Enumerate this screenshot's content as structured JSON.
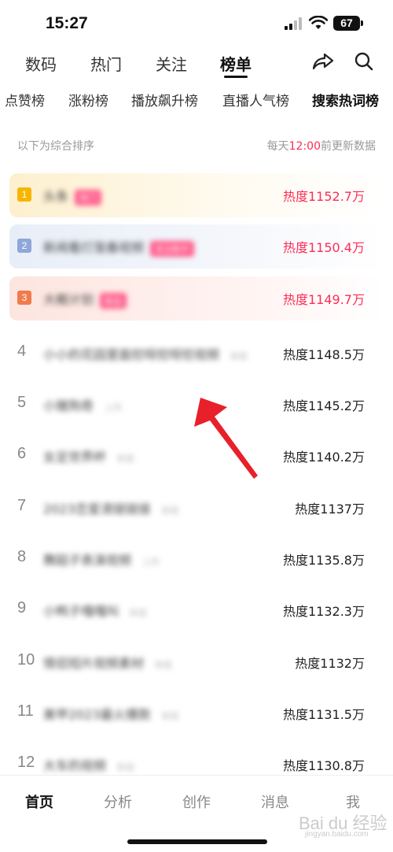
{
  "status": {
    "time": "15:27",
    "battery": "67"
  },
  "topnav": {
    "tabs": [
      "数码",
      "热门",
      "关注",
      "榜单"
    ],
    "active_tab": "榜单"
  },
  "subtabs": [
    "点赞榜",
    "涨粉榜",
    "播放飙升榜",
    "直播人气榜",
    "搜索热词榜"
  ],
  "notes": {
    "left": "以下为综合排序",
    "right_prefix": "每天",
    "right_time": "12:00",
    "right_suffix": "前更新数据"
  },
  "rows": [
    {
      "rank": "1",
      "title": "头条",
      "tag": "热门",
      "heat": "热度1152.7万"
    },
    {
      "rank": "2",
      "title": "新闻看灯笼春视频",
      "tag": "关注新中",
      "heat": "热度1150.4万"
    },
    {
      "rank": "3",
      "title": "大概计划",
      "tag": "新品",
      "heat": "热度1149.7万"
    },
    {
      "rank": "4",
      "title": "小小的花园里面挖呀挖呀挖视频",
      "tag": "新版",
      "heat": "热度1148.5万"
    },
    {
      "rank": "5",
      "title": "小猪狗奇",
      "tag": "上热",
      "heat": "热度1145.2万"
    },
    {
      "rank": "6",
      "title": "女足世界杯",
      "tag": "新版",
      "heat": "热度1140.2万"
    },
    {
      "rank": "7",
      "title": "2023恋爱清链链接",
      "tag": "新版",
      "heat": "热度1137万"
    },
    {
      "rank": "8",
      "title": "舞蹈子表演视频",
      "tag": "上热",
      "heat": "热度1135.8万"
    },
    {
      "rank": "9",
      "title": "小鸭子嘎嘎叫",
      "tag": "新版",
      "heat": "热度1132.3万"
    },
    {
      "rank": "10",
      "title": "情侣短片视频素材",
      "tag": "新版",
      "heat": "热度1132万"
    },
    {
      "rank": "11",
      "title": "美甲2023最火爆款",
      "tag": "新版",
      "heat": "热度1131.5万"
    },
    {
      "rank": "12",
      "title": "大车的视频",
      "tag": "新版",
      "heat": "热度1130.8万"
    }
  ],
  "bottombar": {
    "items": [
      "首页",
      "分析",
      "创作",
      "消息",
      "我"
    ],
    "active": "首页"
  },
  "watermark": {
    "main": "Bai du 经验",
    "sub": "jingyan.baidu.com"
  },
  "colors": {
    "accent": "#fe2c55",
    "badge1": "#f7b500",
    "badge2": "#8fa6d8",
    "badge3": "#f27b4c",
    "arrow": "#e8202a"
  }
}
